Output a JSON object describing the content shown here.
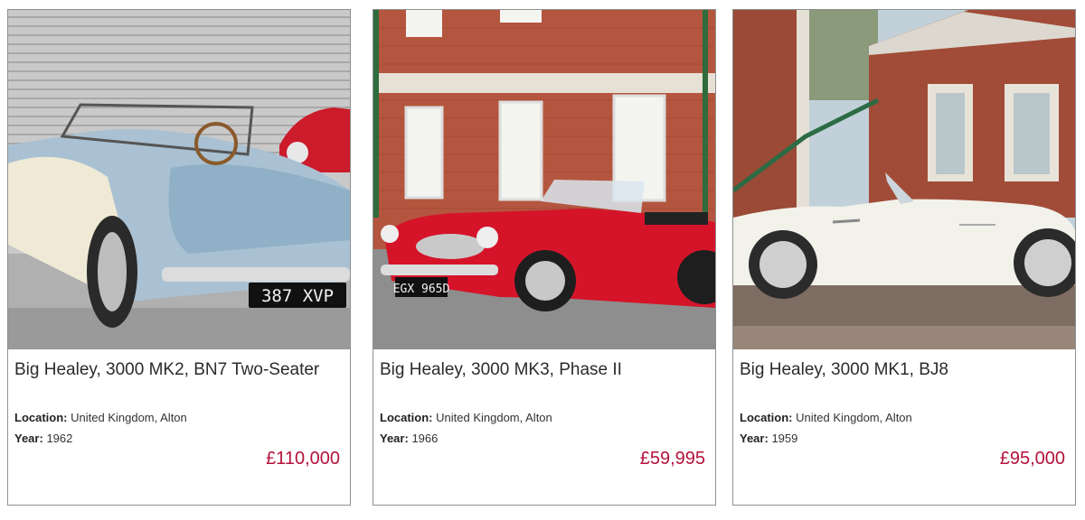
{
  "listings": [
    {
      "title": "Big Healey, 3000 MK2, BN7 Two-Seater",
      "location_label": "Location:",
      "location": "United Kingdom, Alton",
      "year_label": "Year:",
      "year": "1962",
      "price": "£110,000",
      "plate": "387 XVP",
      "car_color": "#a9c1d2"
    },
    {
      "title": "Big Healey, 3000 MK3, Phase II",
      "location_label": "Location:",
      "location": "United Kingdom, Alton",
      "year_label": "Year:",
      "year": "1966",
      "price": "£59,995",
      "plate": "EGX 965D",
      "car_color": "#d5142a"
    },
    {
      "title": "Big Healey, 3000 MK1, BJ8",
      "location_label": "Location:",
      "location": "United Kingdom, Alton",
      "year_label": "Year:",
      "year": "1959",
      "price": "£95,000",
      "car_color": "#f2f1ea"
    }
  ],
  "colors": {
    "price": "#b4123a",
    "border": "#8f8f8f"
  }
}
